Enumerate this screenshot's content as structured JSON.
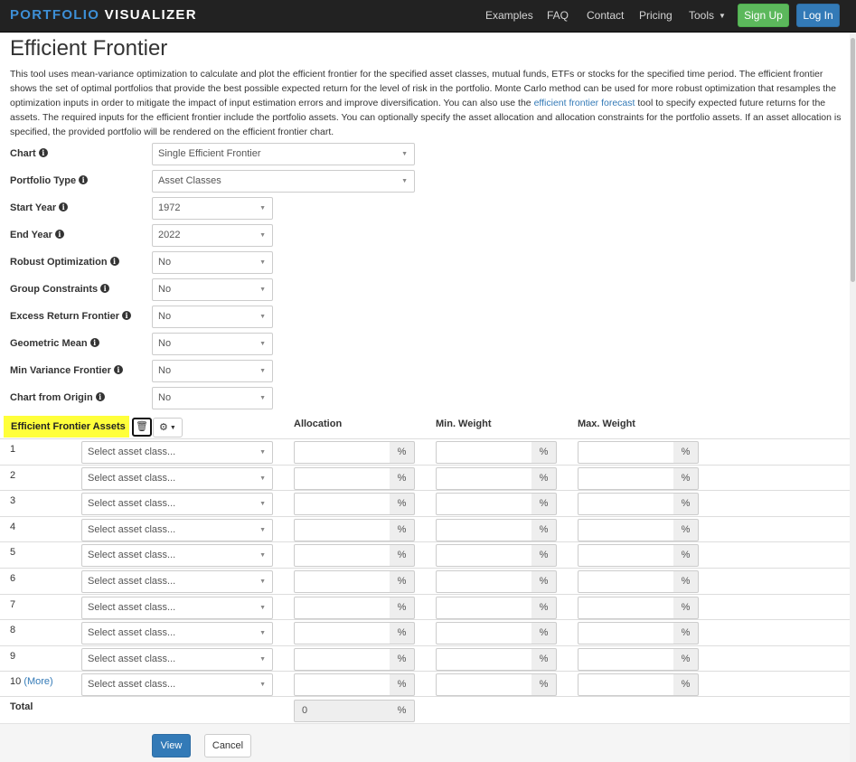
{
  "nav": {
    "brand_part1": "PORTFOLIO",
    "brand_part2": "VISUALIZER",
    "examples": "Examples",
    "faq": "FAQ",
    "contact": "Contact",
    "pricing": "Pricing",
    "tools": "Tools",
    "signup": "Sign Up",
    "login": "Log In"
  },
  "page": {
    "title": "Efficient Frontier",
    "desc_before_link": "This tool uses mean-variance optimization to calculate and plot the efficient frontier for the specified asset classes, mutual funds, ETFs or stocks for the specified time period. The efficient frontier shows the set of optimal portfolios that provide the best possible expected return for the level of risk in the portfolio. Monte Carlo method can be used for more robust optimization that resamples the optimization inputs in order to mitigate the impact of input estimation errors and improve diversification. You can also use the ",
    "desc_link": "efficient frontier forecast",
    "desc_after_link": " tool to specify expected future returns for the assets. The required inputs for the efficient frontier include the portfolio assets. You can optionally specify the asset allocation and allocation constraints for the portfolio assets. If an asset allocation is specified, the provided portfolio will be rendered on the efficient frontier chart."
  },
  "form": {
    "chart": {
      "label": "Chart",
      "value": "Single Efficient Frontier"
    },
    "portfolio_type": {
      "label": "Portfolio Type",
      "value": "Asset Classes"
    },
    "start_year": {
      "label": "Start Year",
      "value": "1972"
    },
    "end_year": {
      "label": "End Year",
      "value": "2022"
    },
    "robust_optimization": {
      "label": "Robust Optimization",
      "value": "No"
    },
    "group_constraints": {
      "label": "Group Constraints",
      "value": "No"
    },
    "excess_return_frontier": {
      "label": "Excess Return Frontier",
      "value": "No"
    },
    "geometric_mean": {
      "label": "Geometric Mean",
      "value": "No"
    },
    "min_variance_frontier": {
      "label": "Min Variance Frontier",
      "value": "No"
    },
    "chart_from_origin": {
      "label": "Chart from Origin",
      "value": "No"
    }
  },
  "assets": {
    "section_label": "Efficient Frontier Assets",
    "col_allocation": "Allocation",
    "col_min_weight": "Min. Weight",
    "col_max_weight": "Max. Weight",
    "select_placeholder": "Select asset class...",
    "percent": "%",
    "more_label": "(More)",
    "rows": [
      "1",
      "2",
      "3",
      "4",
      "5",
      "6",
      "7",
      "8",
      "9",
      "10"
    ],
    "total_label": "Total",
    "total_value": "0"
  },
  "buttons": {
    "view": "View",
    "cancel": "Cancel"
  },
  "icons": {
    "info": "info-circle-icon",
    "trash": "trash-icon",
    "gear": "gear-icon",
    "caret": "caret-down-icon"
  }
}
